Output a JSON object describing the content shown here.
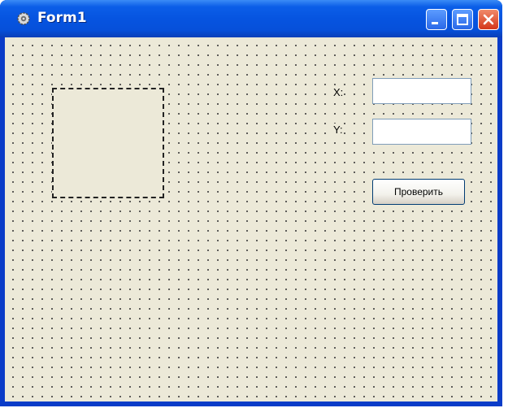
{
  "window": {
    "title": "Form1",
    "icon": "gear-icon",
    "controls": [
      "minimize-icon",
      "maximize-icon",
      "close-icon"
    ],
    "colors": {
      "titlebar": "#0654e0",
      "client": "#ece9d8",
      "close": "#d4361a"
    }
  },
  "form": {
    "x_label": "X:",
    "y_label": "Y:",
    "x_value": "",
    "y_value": "",
    "check_button": "Проверить"
  }
}
